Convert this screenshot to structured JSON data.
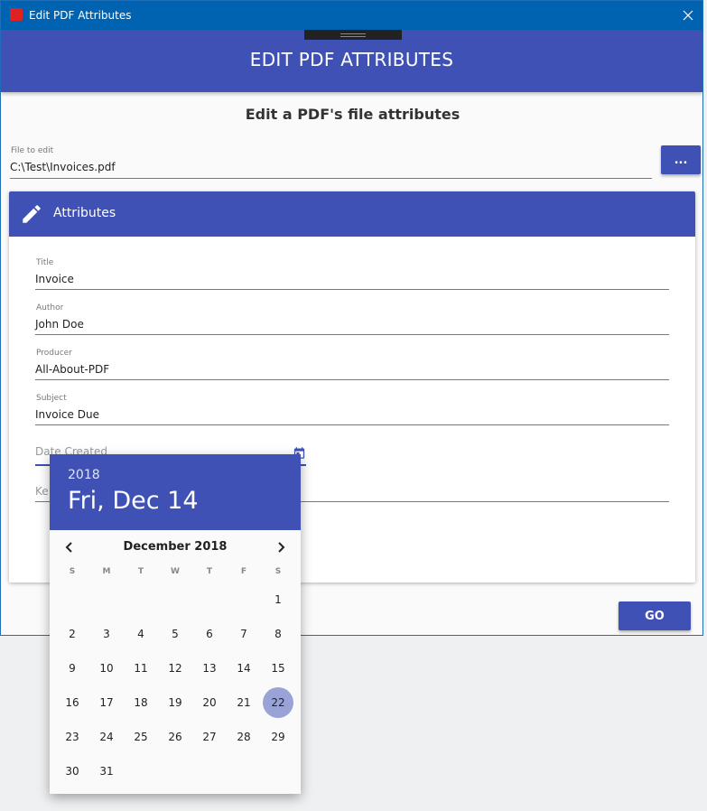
{
  "window": {
    "title": "Edit PDF Attributes"
  },
  "header": {
    "title": "EDIT PDF ATTRIBUTES"
  },
  "subtitle": "Edit a PDF's file attributes",
  "file": {
    "label": "File to edit",
    "value": "C:\\Test\\Invoices.pdf",
    "browse_label": "..."
  },
  "attributes": {
    "title": "Attributes",
    "fields": {
      "title": {
        "label": "Title",
        "value": "Invoice"
      },
      "author": {
        "label": "Author",
        "value": "John Doe"
      },
      "producer": {
        "label": "Producer",
        "value": "All-About-PDF"
      },
      "subject": {
        "label": "Subject",
        "value": "Invoice Due"
      },
      "date_created": {
        "placeholder": "Date Created"
      },
      "keywords": {
        "placeholder_partial": "Ke"
      }
    }
  },
  "go_label": "GO",
  "datepicker": {
    "year": "2018",
    "date": "Fri, Dec 14",
    "month": "December 2018",
    "dow": [
      "S",
      "M",
      "T",
      "W",
      "T",
      "F",
      "S"
    ],
    "days": [
      "1",
      "2",
      "3",
      "4",
      "5",
      "6",
      "7",
      "8",
      "9",
      "10",
      "11",
      "12",
      "13",
      "14",
      "15",
      "16",
      "17",
      "18",
      "19",
      "20",
      "21",
      "22",
      "23",
      "24",
      "25",
      "26",
      "27",
      "28",
      "29",
      "30",
      "31"
    ],
    "selected": "22",
    "first_weekday_index": 6
  },
  "colors": {
    "primary": "#3f51b5",
    "titlebar": "#0063b1",
    "selected_day": "#9aa3d8"
  }
}
